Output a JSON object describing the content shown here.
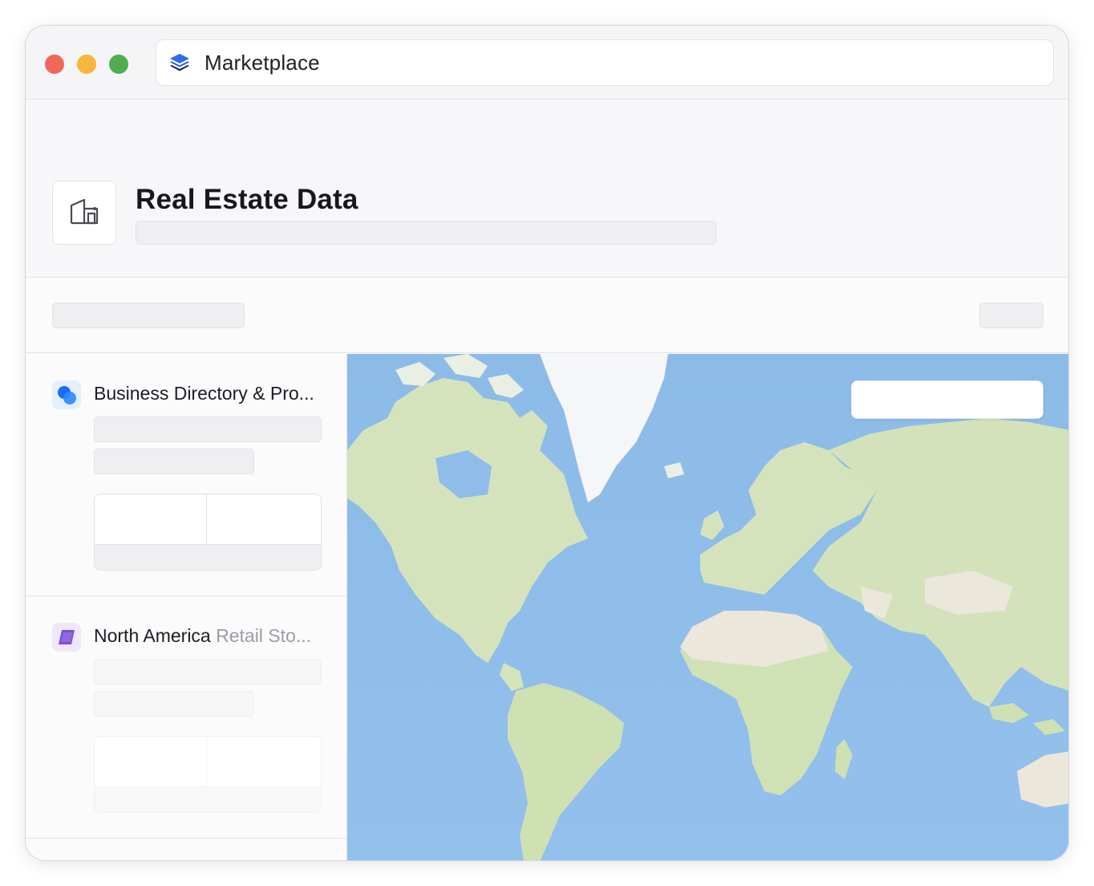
{
  "browser": {
    "title": "Marketplace",
    "logo_icon": "layers-stack-icon",
    "traffic_lights": [
      "#f0685a",
      "#f6b73c",
      "#50ad50"
    ]
  },
  "header": {
    "category_icon": "building-icon",
    "title": "Real Estate Data"
  },
  "listings": [
    {
      "title": "Business Directory & Pro...",
      "icon": "overlapping-circles-icon",
      "accent": "#1a6cf5"
    },
    {
      "title_main": "North America",
      "title_faded": " Retail Sto...",
      "icon": "purple-shape-icon",
      "accent": "#7b4fd6"
    }
  ],
  "map": {
    "ocean_color": "#8fbde9",
    "land_color": "#d7e4c1",
    "ice_color": "#f4f6f7",
    "desert_color": "#ebe7da"
  }
}
